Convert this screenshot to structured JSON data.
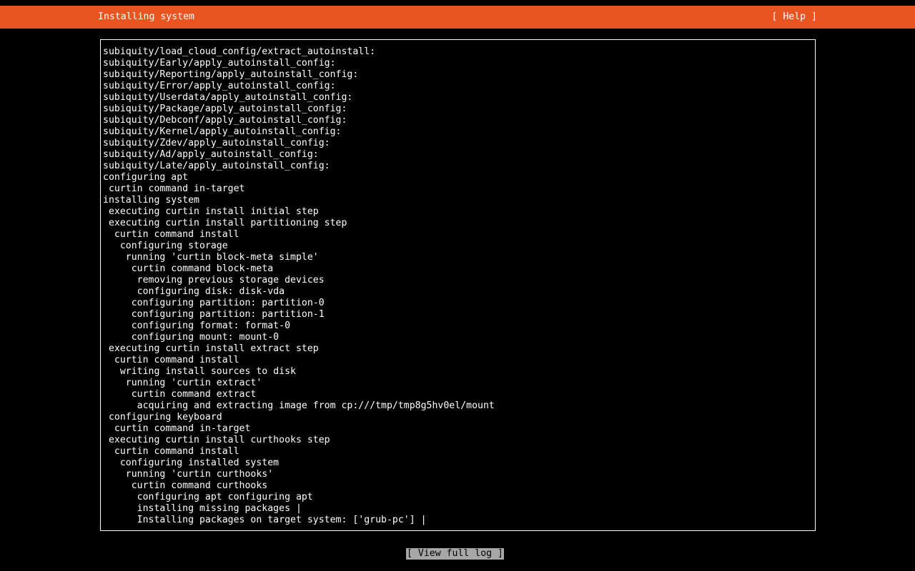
{
  "header": {
    "title": "Installing system",
    "help_label": "[ Help ]",
    "bg_color": "#e95420"
  },
  "log": {
    "lines": [
      "subiquity/load_cloud_config/extract_autoinstall:",
      "subiquity/Early/apply_autoinstall_config:",
      "subiquity/Reporting/apply_autoinstall_config:",
      "subiquity/Error/apply_autoinstall_config:",
      "subiquity/Userdata/apply_autoinstall_config:",
      "subiquity/Package/apply_autoinstall_config:",
      "subiquity/Debconf/apply_autoinstall_config:",
      "subiquity/Kernel/apply_autoinstall_config:",
      "subiquity/Zdev/apply_autoinstall_config:",
      "subiquity/Ad/apply_autoinstall_config:",
      "subiquity/Late/apply_autoinstall_config:",
      "configuring apt",
      " curtin command in-target",
      "installing system",
      " executing curtin install initial step",
      " executing curtin install partitioning step",
      "  curtin command install",
      "   configuring storage",
      "    running 'curtin block-meta simple'",
      "     curtin command block-meta",
      "      removing previous storage devices",
      "      configuring disk: disk-vda",
      "     configuring partition: partition-0",
      "     configuring partition: partition-1",
      "     configuring format: format-0",
      "     configuring mount: mount-0",
      " executing curtin install extract step",
      "  curtin command install",
      "   writing install sources to disk",
      "    running 'curtin extract'",
      "     curtin command extract",
      "      acquiring and extracting image from cp:///tmp/tmp8g5hv0el/mount",
      " configuring keyboard",
      "  curtin command in-target",
      " executing curtin install curthooks step",
      "  curtin command install",
      "   configuring installed system",
      "    running 'curtin curthooks'",
      "     curtin command curthooks",
      "      configuring apt configuring apt",
      "      installing missing packages |",
      "      Installing packages on target system: ['grub-pc'] |"
    ]
  },
  "footer": {
    "view_full_log_label": "[ View full log ]"
  }
}
